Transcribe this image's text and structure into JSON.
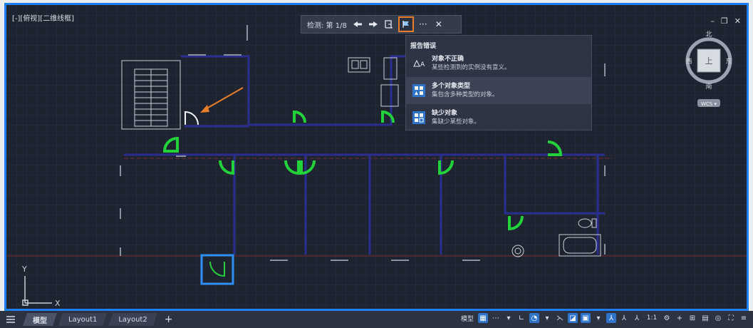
{
  "viewport": {
    "label": "[-][俯视][二维线框]"
  },
  "nav_toolbar": {
    "label": "检测: 第 1/8",
    "prev_icon": "arrow-left-icon",
    "next_icon": "arrow-right-icon",
    "door_icon": "door-icon",
    "report_icon": "flag-icon",
    "more_label": "···",
    "close_label": "✕"
  },
  "issue_menu": {
    "title": "报告错误",
    "items": [
      {
        "title": "对象不正确",
        "desc": "某些检测到的实例没有意义。",
        "icon": "wrong-object-icon"
      },
      {
        "title": "多个对象类型",
        "desc": "集包含多种类型的对象。",
        "icon": "multiple-types-icon"
      },
      {
        "title": "缺少对象",
        "desc": "集缺少某些对象。",
        "icon": "missing-object-icon"
      }
    ]
  },
  "window_controls": {
    "minimize": "–",
    "restore": "❐",
    "close": "✕"
  },
  "viewcube": {
    "north": "北",
    "south": "南",
    "east": "东",
    "west": "西",
    "face": "上",
    "wcs": "WCS ▾"
  },
  "ucs": {
    "x_label": "X",
    "y_label": "Y"
  },
  "statusbar": {
    "tabs": [
      "模型",
      "Layout1",
      "Layout2"
    ],
    "add_tab": "+",
    "model_label": "模型",
    "scale_label": "1:1"
  },
  "colors": {
    "accent": "#1f7ff0",
    "highlight": "#e87e2a",
    "door": "#23d23a",
    "wall": "#2a2f8f",
    "canvas": "#1e2330"
  }
}
